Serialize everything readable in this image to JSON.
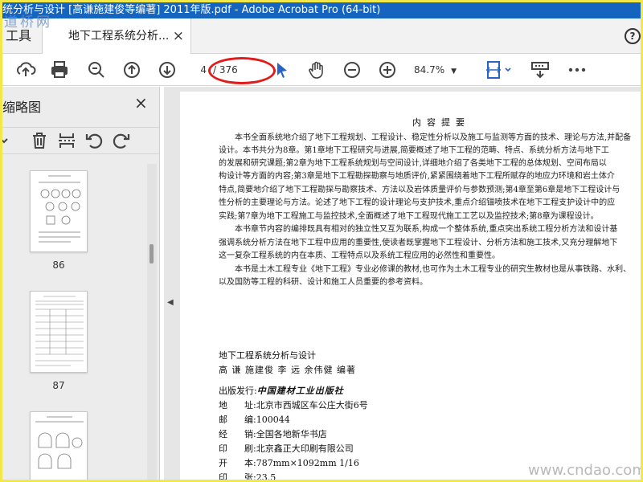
{
  "window": {
    "title": "统分析与设计 [高谦施建俊等编著] 2011年版.pdf - Adobe Acrobat Pro (64-bit)",
    "watermark_top": "道桥网"
  },
  "tabs": {
    "tools_label": "工具",
    "doc_tab_label": "地下工程系统分析...",
    "doc_tab_close": "×",
    "help": "?"
  },
  "toolbar": {
    "current_page": "4",
    "total_pages": "/ 376",
    "zoom": "84.7%",
    "icons": [
      "upload-icon",
      "print-icon",
      "zoom-out-search-icon",
      "page-up-icon",
      "page-down-icon",
      "cursor-arrow-icon",
      "hand-icon",
      "zoom-minus-icon",
      "zoom-plus-icon",
      "fit-page-icon",
      "scroll-mode-icon",
      "more-icon"
    ]
  },
  "sidebar": {
    "title": "缩略图",
    "close": "×",
    "thumbnails": [
      {
        "label": "86"
      },
      {
        "label": "87"
      },
      {
        "label": ""
      }
    ]
  },
  "document": {
    "section_title": "内容提要",
    "paragraphs": [
      "本书全面系统地介绍了地下工程规划、工程设计、稳定性分析以及施工与监测等方面的技术、理论与方法,并配备",
      "设计。本书共分为8章。第1章地下工程研究与进展,简要概述了地下工程的范畴、特点、系统分析方法与地下工",
      "的发展和研究课题;第2章为地下工程系统规划与空间设计,详细地介绍了各类地下工程的总体规划、空间布局以",
      "构设计等方面的内容;第3章是地下工程勘探勘察与地质评价,紧紧围绕着地下工程所赋存的地应力环境和岩土体介",
      "特点,简要地介绍了地下工程勘探与勘察技术、方法以及岩体质量评价与参数预测;第4章至第6章是地下工程设计与",
      "性分析的主要理论与方法。论述了地下工程的设计理论与支护技术,重点介绍锚喷技术在地下工程支护设计中的应",
      "实践;第7章为地下工程施工与监控技术,全面概述了地下工程现代施工工艺以及监控技术;第8章为课程设计。",
      "本书章节内容的编排既具有相对的独立性又互为联系,构成一个整体系统,重点突出系统工程分析方法和设计基",
      "强调系统分析方法在地下工程中应用的重要性,使读者既掌握地下工程设计、分析方法和施工技术,又充分理解地下",
      "这一复杂工程系统的内在本质、工程特点以及系统工程应用的必然性和重要性。",
      "本书是土木工程专业《地下工程》专业必修课的教材,也可作为土木工程专业的研究生教材也是从事铁路、水利、",
      "以及国防等工程的科研、设计和施工人员重要的参考资料。"
    ],
    "book_title": "地下工程系统分析与设计",
    "authors": "高  谦  施建俊  李  远  余伟健  编著",
    "publisher_label": "出版发行:",
    "publisher_name": "中国建材工业出版社",
    "rows": [
      {
        "k": "地",
        "k2": "址",
        "v": ":北京市西城区车公庄大街6号"
      },
      {
        "k": "邮",
        "k2": "编",
        "v": ":100044"
      },
      {
        "k": "经",
        "k2": "销",
        "v": ":全国各地新华书店"
      },
      {
        "k": "印",
        "k2": "刷",
        "v": ":北京鑫正大印刷有限公司"
      },
      {
        "k": "开",
        "k2": "本",
        "v": ":787mm×1092mm  1/16"
      },
      {
        "k": "印",
        "k2": "张",
        "v": ":23.5"
      }
    ]
  },
  "watermark_bottom": "www.cndao.com",
  "colors": {
    "titlebar": "#1565c0",
    "annotation": "#e21b1b",
    "frame": "#f2e84a"
  }
}
